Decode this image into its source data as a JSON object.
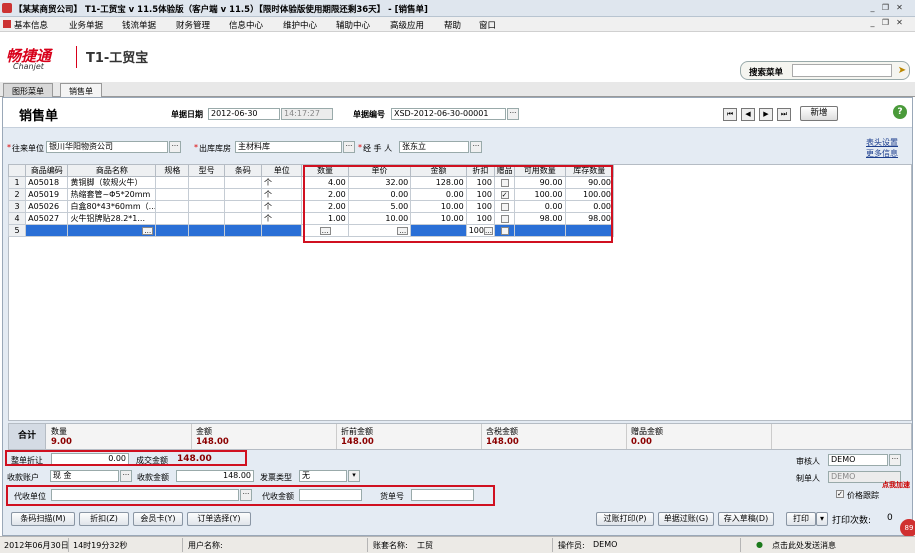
{
  "window": {
    "title": "【某某商贸公司】 T1-工贸宝 v 11.5体验版（客户端 v 11.5）【限时体验版使用期限还剩36天】 - [销售单]"
  },
  "menu": [
    "基本信息",
    "业务单据",
    "钱流单据",
    "财务管理",
    "信息中心",
    "维护中心",
    "辅助中心",
    "高级应用",
    "帮助",
    "窗口"
  ],
  "brand": {
    "logo_cn": "畅捷通",
    "logo_en": "Chanjet",
    "product": "T1-工贸宝"
  },
  "search": {
    "label": "搜索菜单",
    "value": ""
  },
  "tabs": [
    "图形菜单",
    "销售单"
  ],
  "doc": {
    "title": "销售单",
    "date_label": "单据日期",
    "date": "2012-06-30",
    "time": "14:17:27",
    "no_label": "单据编号",
    "no": "XSD-2012-06-30-00001",
    "new_label": "新增",
    "help": "?"
  },
  "party": {
    "customer_label": "往来单位",
    "customer": "银川华阳物资公司",
    "warehouse_label": "出库库房",
    "warehouse": "主材料库",
    "handler_label": "经 手 人",
    "handler": "张东立",
    "req": "*"
  },
  "links": {
    "header_settings": "表头设置",
    "more_info": "更多信息"
  },
  "grid": {
    "columns": [
      "",
      "商品编码",
      "商品名称",
      "规格",
      "型号",
      "条码",
      "单位",
      "数量",
      "单价",
      "金额",
      "折扣",
      "赠品",
      "可用数量",
      "库存数量"
    ],
    "rows": [
      {
        "idx": "1",
        "code": "A05018",
        "name": "黄铜脚（软规火牛）",
        "unit": "个",
        "qty": "4.00",
        "price": "32.00",
        "amount": "128.00",
        "disc": "100",
        "gift": false,
        "avail": "90.00",
        "stock": "90.00"
      },
      {
        "idx": "2",
        "code": "A05019",
        "name": "热缩套管~Φ5*20mm",
        "unit": "个",
        "qty": "2.00",
        "price": "0.00",
        "amount": "0.00",
        "disc": "100",
        "gift": true,
        "avail": "100.00",
        "stock": "100.00"
      },
      {
        "idx": "3",
        "code": "A05026",
        "name": "白盒80*43*60mm（...",
        "unit": "个",
        "qty": "2.00",
        "price": "5.00",
        "amount": "10.00",
        "disc": "100",
        "gift": false,
        "avail": "0.00",
        "stock": "0.00"
      },
      {
        "idx": "4",
        "code": "A05027",
        "name": "火牛铝牌贴28.2*1...",
        "unit": "个",
        "qty": "1.00",
        "price": "10.00",
        "amount": "10.00",
        "disc": "100",
        "gift": false,
        "avail": "98.00",
        "stock": "98.00"
      }
    ],
    "new_row": {
      "idx": "5",
      "disc": "100"
    }
  },
  "totals": {
    "label": "合计",
    "qty_label": "数量",
    "qty": "9.00",
    "amount_label": "金额",
    "amount": "148.00",
    "pre_disc_label": "折前金额",
    "pre_disc": "148.00",
    "tax_label": "含税金额",
    "tax": "148.00",
    "gift_label": "赠品金额",
    "gift": "0.00"
  },
  "payment": {
    "whole_disc_label": "整单折让",
    "whole_disc": "0.00",
    "deal_label": "成交金额",
    "deal": "148.00",
    "account_label": "收款账户",
    "account": "现    金",
    "collected_label": "收款金额",
    "collected": "148.00",
    "invoice_label": "发票类型",
    "invoice": "无",
    "agent_label": "代收单位",
    "agent": "",
    "agent_amount_label": "代收金额",
    "agent_amount": "",
    "waybill_label": "货单号",
    "waybill": "",
    "auditor_label": "审核人",
    "auditor": "DEMO",
    "maker_label": "制单人",
    "maker": "DEMO",
    "price_track": "价格跟踪"
  },
  "buttons": {
    "barcode": "条码扫描(M)",
    "discount": "折扣(Z)",
    "member": "会员卡(Y)",
    "order": "订单选择(Y)",
    "post_print": "过账打印(P)",
    "post": "单据过账(G)",
    "draft": "存入草稿(D)",
    "print": "打印",
    "print_count_label": "打印次数:",
    "print_count": "0"
  },
  "status": {
    "date": "2012年06月30日",
    "time": "14时19分32秒",
    "user_label": "用户名称:",
    "user": "",
    "account_label": "账套名称:",
    "account": "工贸",
    "operator_label": "操作员:",
    "operator": "DEMO",
    "send": "点击此处发送消息",
    "badge": "89",
    "addfast": "点我加速"
  }
}
